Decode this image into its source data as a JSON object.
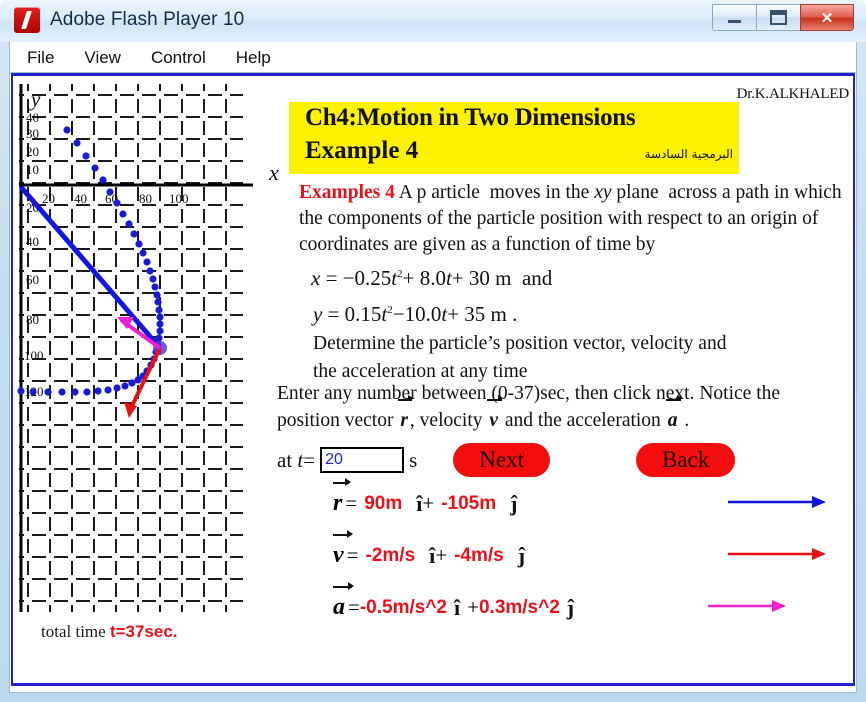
{
  "window": {
    "title": "Adobe Flash Player 10",
    "ghost_title": "",
    "minimize_label": "",
    "maximize_label": "",
    "close_label": "✕",
    "logo_icon": "flash-logo-icon"
  },
  "menu": {
    "items": [
      {
        "label": "File"
      },
      {
        "label": "View"
      },
      {
        "label": "Control"
      },
      {
        "label": "Help"
      }
    ]
  },
  "header": {
    "author": "Dr.K.ALKHALED",
    "banner_line1": "Ch4:Motion in Two Dimensions",
    "banner_line2": "Example 4",
    "banner_arabic": "البرمجية السادسة",
    "banner_color": "#fff200"
  },
  "problem": {
    "label": "Examples 4",
    "text": "A p article  moves in the xy plane across a path in which the components of the particle position with respect to an origin of coordinates are given as a function of time by",
    "equation_x": "x = −0.25t² + 8.0t + 30 m  and",
    "equation_y": "y = 0.15t² − 10.0t + 35 m .",
    "determine_line1": "Determine  the  particle’s    position vector,  velocity  and",
    "determine_line2": "the  acceleration  at any time"
  },
  "instructions": {
    "line1": "Enter any number between (0-37)sec, then click next. Notice the",
    "line2_a": "position vector",
    "line2_r": "r",
    "line2_b": ", velocity",
    "line2_v": "v",
    "line2_c": "and the acceleration",
    "line2_a2": "a",
    "line2_end": "."
  },
  "controls": {
    "at_label": "at t=",
    "time_value": "20",
    "time_placeholder": "",
    "unit_label": "s",
    "next_label": "Next",
    "back_label": "Back",
    "button_color": "#f40d0d"
  },
  "results": [
    {
      "symbol": "r",
      "equals": "=",
      "x_value": "90m",
      "i_hat": "î",
      "plus": "+",
      "y_value": "-105m",
      "j_hat": "ĵ",
      "arrow_color": "#1414e0",
      "name": "position-vector"
    },
    {
      "symbol": "v",
      "equals": "=",
      "x_value": "-2m/s",
      "i_hat": "î",
      "plus": "+",
      "y_value": "-4m/s",
      "j_hat": "ĵ",
      "arrow_color": "#e81010",
      "name": "velocity-vector"
    },
    {
      "symbol": "a",
      "equals": "=",
      "x_value": "-0.5m/s^2",
      "i_hat": "î",
      "plus": "+",
      "y_value": "0.3m/s^2",
      "j_hat": "ĵ",
      "arrow_color": "#f020d0",
      "name": "acceleration-vector"
    }
  ],
  "graph": {
    "x_axis_label": "x",
    "y_axis_label": "y",
    "total_time_label": "total time ",
    "total_time_value": "t=37sec.",
    "x_ticks": [
      "20",
      "40",
      "60",
      "80",
      "100"
    ],
    "y_ticks_pos": [
      "40",
      "30",
      "20",
      "10"
    ],
    "y_ticks_neg": [
      "20",
      "40",
      "60",
      "80",
      "100",
      "120"
    ],
    "trajectory_color": "#1a1ad0",
    "position_vector_color": "#1414e0",
    "velocity_vector_color": "#e81010",
    "acceleration_vector_color": "#f020d0"
  },
  "chart_data": {
    "type": "scatter",
    "title": "",
    "xlabel": "x",
    "ylabel": "y",
    "xlim": [
      -10,
      130
    ],
    "ylim": [
      -135,
      45
    ],
    "grid": true,
    "legend": "none",
    "series": [
      {
        "name": "particle trajectory",
        "x": [
          30,
          37.75,
          45,
          51.75,
          58,
          63.75,
          69,
          73.75,
          78,
          81.75,
          85,
          87.75,
          90,
          91.75,
          93,
          93.75,
          94,
          93.75,
          93,
          91.75,
          90,
          87.75,
          85,
          81.75,
          78,
          73.75,
          69,
          63.75,
          58,
          51.75,
          45,
          37.75,
          30,
          21.75,
          13,
          3.75,
          -6,
          -16.25
        ],
        "y": [
          35,
          25.15,
          15.6,
          6.35,
          -2.6,
          -11.25,
          -19.6,
          -27.65,
          -35.4,
          -42.85,
          -50,
          -56.85,
          -63.4,
          -69.65,
          -75.6,
          -81.25,
          -86.6,
          -91.65,
          -96.4,
          -100.85,
          -105,
          -108.85,
          -112.4,
          -115.65,
          -118.6,
          -121.25,
          -123.6,
          -125.65,
          -127.4,
          -128.85,
          -130,
          -130.85,
          -131.4,
          -131.65,
          -131.6,
          -131.25,
          -130.6,
          -129.65
        ]
      }
    ],
    "annotations": [
      {
        "label": "position vector r",
        "type": "arrow",
        "from": [
          0,
          0
        ],
        "to": [
          90,
          -105
        ],
        "color": "#1414e0"
      },
      {
        "label": "velocity vector v",
        "type": "arrow",
        "from": [
          90,
          -105
        ],
        "to": [
          70,
          -145
        ],
        "color": "#e81010"
      },
      {
        "label": "acceleration vector a",
        "type": "arrow",
        "from": [
          90,
          -105
        ],
        "to": [
          70,
          -95
        ],
        "color": "#f020d0"
      },
      {
        "label": "current time",
        "value": "20",
        "unit": "s"
      },
      {
        "label": "total time",
        "value": "37",
        "unit": "sec."
      }
    ]
  }
}
